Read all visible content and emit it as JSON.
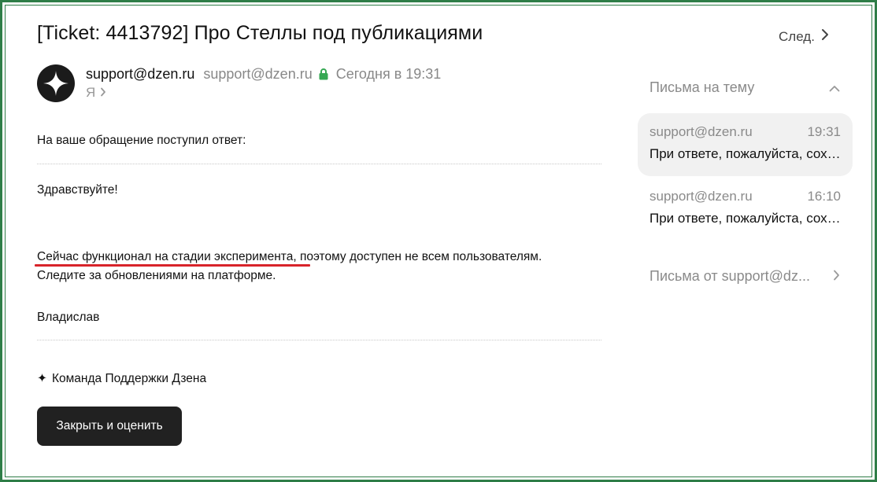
{
  "email": {
    "subject": "[Ticket: 4413792] Про Стеллы под публикациями",
    "next_label": "След.",
    "sender": {
      "name": "support@dzen.ru",
      "email": "support@dzen.ru",
      "date": "Сегодня в 19:31",
      "recipient": "Я"
    },
    "body": {
      "intro": "На ваше обращение поступил ответ:",
      "greeting": "Здравствуйте!",
      "line1_highlighted": "Сейчас функционал на стадии эксперимента",
      "line1_rest": ", поэтому доступен не всем пользователям.",
      "line2": "Следите за обновлениями на платформе.",
      "signature": "Владислав",
      "team_icon": "✦",
      "team": "Команда Поддержки Дзена"
    },
    "action_button": "Закрыть и оценить"
  },
  "sidebar": {
    "thread_header": "Письма на тему",
    "threads": [
      {
        "from": "support@dzen.ru",
        "time": "19:31",
        "preview": "При ответе, пожалуйста, сохраните",
        "active": true
      },
      {
        "from": "support@dzen.ru",
        "time": "16:10",
        "preview": "При ответе, пожалуйста, сохраните",
        "active": false
      }
    ],
    "from_sender_label": "Письма от support@dz..."
  },
  "colors": {
    "frame": "#2e7d47",
    "highlight_underline": "#d8232a",
    "button_bg": "#212121",
    "secure_lock": "#35a853"
  },
  "icons": {
    "avatar": "dzen-star-logo",
    "lock": "lock-icon",
    "next": "chevron-right-icon",
    "collapse": "chevron-up-icon"
  }
}
